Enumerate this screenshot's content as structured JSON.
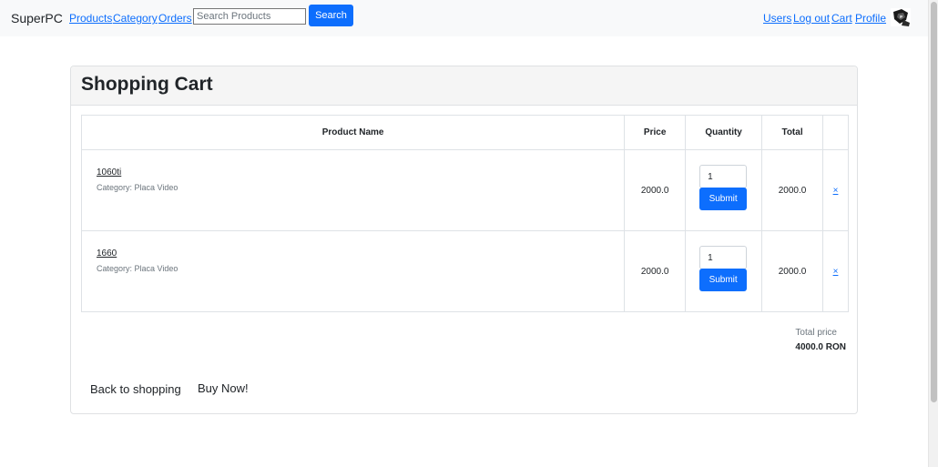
{
  "navbar": {
    "brand": "SuperPC",
    "links": {
      "products": "Products",
      "category": "Category",
      "orders": "Orders",
      "users": "Users",
      "logout": "Log out",
      "cart": "Cart",
      "profile": "Profile"
    },
    "search": {
      "placeholder": "Search Products",
      "value": "",
      "button_label": "Search"
    },
    "avatar_icon": "user-avatar-image"
  },
  "cart": {
    "title": "Shopping Cart",
    "columns": [
      "Product Name",
      "Price",
      "Quantity",
      "Total",
      ""
    ],
    "items": [
      {
        "name": "1060ti",
        "category": "Category: Placa Video",
        "price": "2000.0",
        "quantity": "1",
        "submit_label": "Submit",
        "total": "2000.0",
        "remove": "×"
      },
      {
        "name": "1660",
        "category": "Category: Placa Video",
        "price": "2000.0",
        "quantity": "1",
        "submit_label": "Submit",
        "total": "2000.0",
        "remove": "×"
      }
    ],
    "total_label": "Total price",
    "total_value": "4000.0 RON",
    "back_label": "Back to shopping",
    "buy_label": "Buy Now!"
  },
  "colors": {
    "accent": "#0d6efd",
    "navbar_bg": "#f8f9fa",
    "header_bg": "#f5f5f5"
  }
}
